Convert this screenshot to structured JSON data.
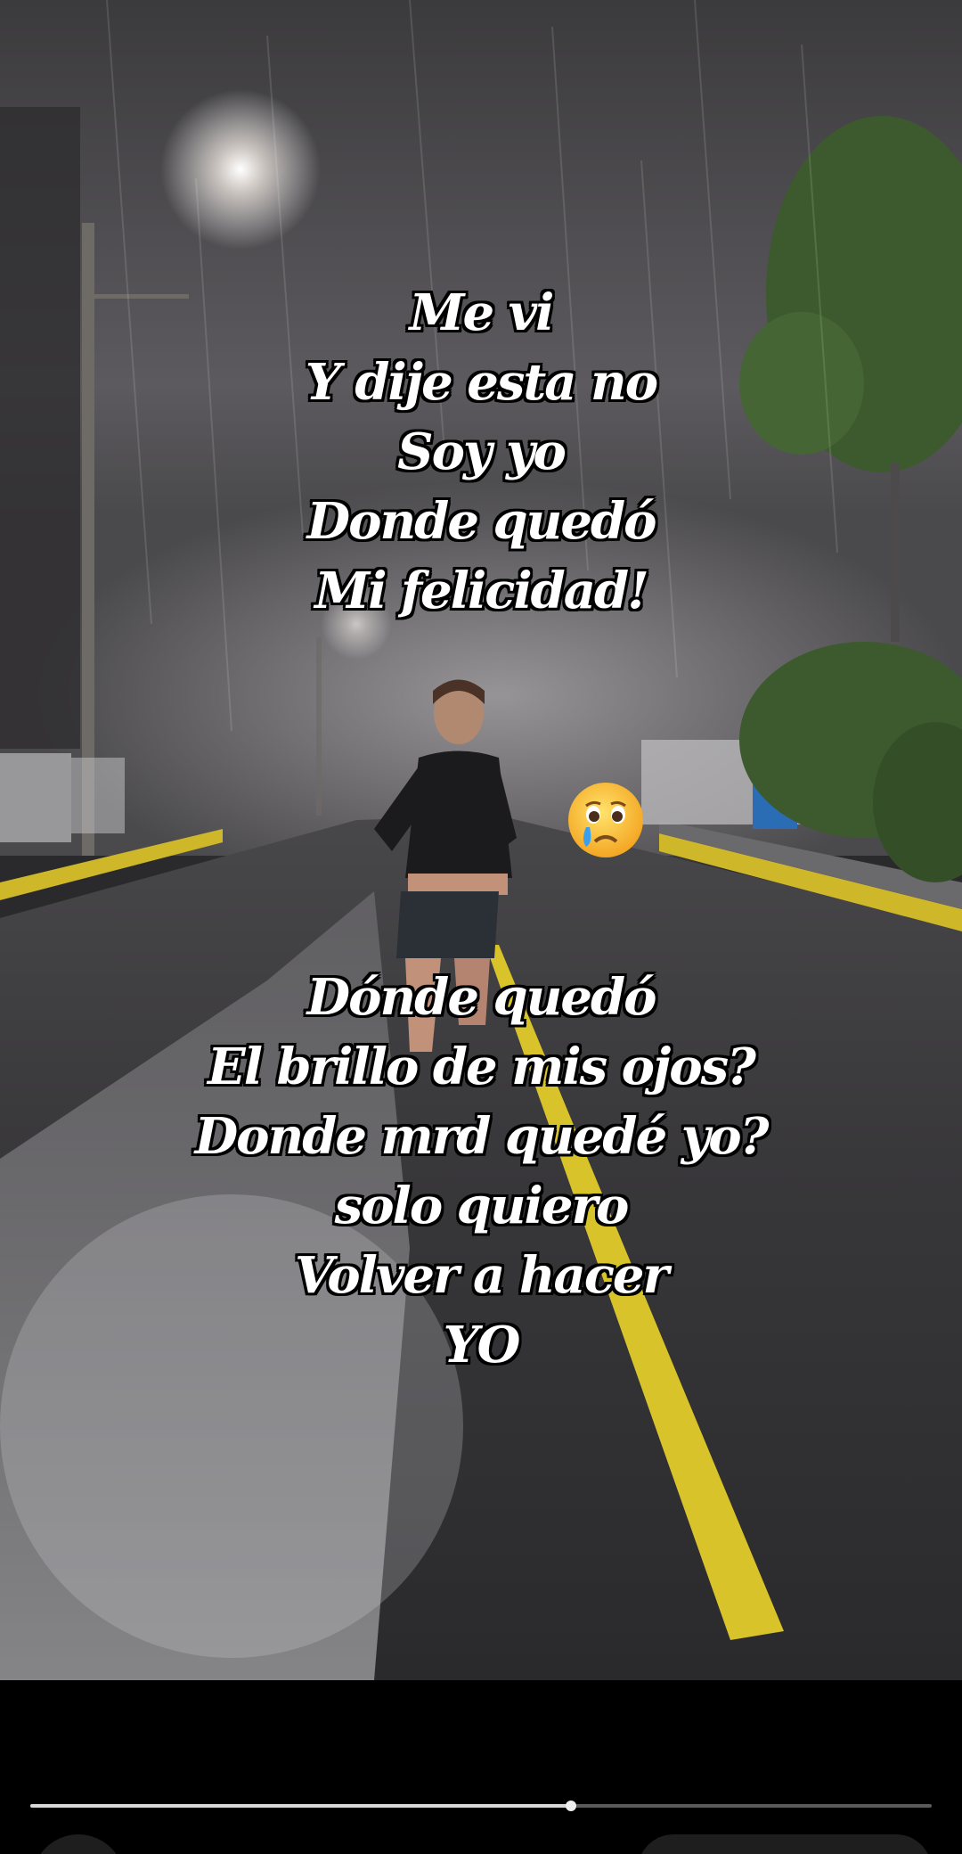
{
  "overlay": {
    "top_lines": [
      "Me vi",
      "Y dije esta no",
      "Soy yo",
      "Donde quedó",
      "Mi felicidad!"
    ],
    "bottom_lines": [
      "Dónde quedó",
      "El brillo de mis ojos?",
      "Donde mrd quedé yo?",
      "solo quiero",
      "Volver a hacer",
      "YO"
    ]
  },
  "emoji": {
    "name": "crying-face-icon"
  },
  "player": {
    "progress": 0.6
  },
  "colors": {
    "road": "#3a3a3c",
    "road_line": "#d9c32a",
    "sky": "#4a4a4e",
    "foliage": "#3d5a2e"
  }
}
